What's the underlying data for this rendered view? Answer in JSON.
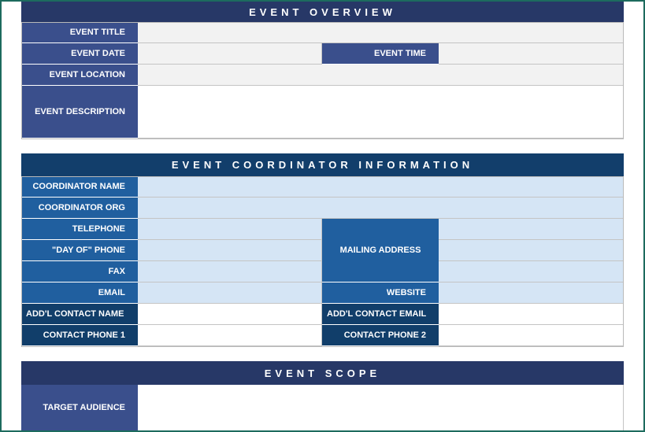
{
  "overview": {
    "title": "EVENT OVERVIEW",
    "labels": {
      "event_title": "EVENT TITLE",
      "event_date": "EVENT DATE",
      "event_time": "EVENT TIME",
      "event_location": "EVENT LOCATION",
      "event_description": "EVENT DESCRIPTION"
    }
  },
  "coordinator": {
    "title": "EVENT COORDINATOR INFORMATION",
    "labels": {
      "coordinator_name": "COORDINATOR NAME",
      "coordinator_org": "COORDINATOR ORG",
      "telephone": "TELEPHONE",
      "day_of_phone": "\"DAY OF\" PHONE",
      "fax": "FAX",
      "email": "EMAIL",
      "mailing_address": "MAILING ADDRESS",
      "website": "WEBSITE",
      "addl_contact_name": "ADD'L CONTACT NAME",
      "addl_contact_email": "ADD'L CONTACT EMAIL",
      "contact_phone_1": "CONTACT PHONE 1",
      "contact_phone_2": "CONTACT PHONE 2"
    }
  },
  "scope": {
    "title": "EVENT SCOPE",
    "labels": {
      "target_audience": "TARGET AUDIENCE"
    }
  }
}
